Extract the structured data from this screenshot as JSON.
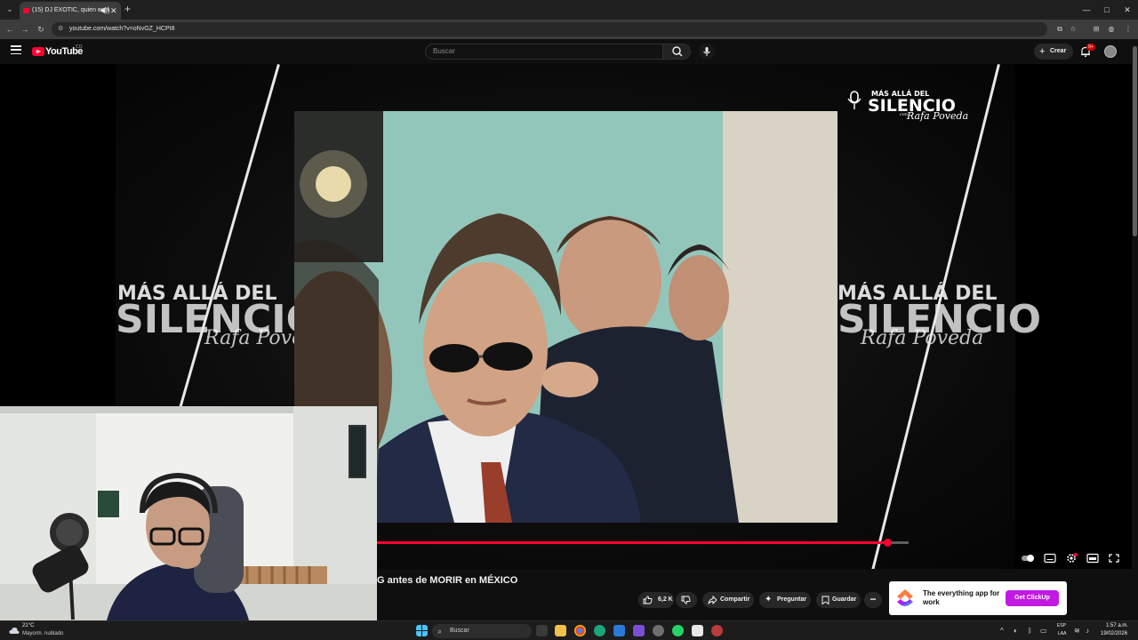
{
  "browser": {
    "tab_title": "(15) DJ EXOTIC, quien está",
    "tab_close": "✕",
    "tab_audio": "◀))",
    "url": "youtube.com/watch?v=oNvGZ_HCPI8",
    "new_tab": "+",
    "window_controls": [
      "—",
      "□",
      "✕"
    ]
  },
  "youtube": {
    "logo_text": "YouTube",
    "country_code": "CO",
    "search_placeholder": "Buscar",
    "create_label": "Crear",
    "notification_count": "9+"
  },
  "video": {
    "overlay_brand_line1": "MÁS ALLÁ DEL",
    "overlay_brand_line2": "SILENCIO",
    "overlay_brand_con": "con",
    "overlay_brand_script": "Rafa Poveda",
    "title": "G antes de MORIR en MÉXICO",
    "progress_fraction": 0.96,
    "icons": [
      "autoplay-toggle-icon",
      "subtitles-icon",
      "settings-icon",
      "miniplayer-icon",
      "fullscreen-icon"
    ]
  },
  "actions": {
    "like_count": "6,2 K",
    "share_label": "Compartir",
    "ask_label": "Preguntar",
    "save_label": "Guardar",
    "more": "•••"
  },
  "ad": {
    "headline": "The everything app for work",
    "cta": "Get ClickUp"
  },
  "taskbar": {
    "weather_temp": "21°C",
    "weather_condition": "Mayorm. nublado",
    "search_label": "Buscar",
    "lang_line1": "ESP",
    "lang_line2": "LAA",
    "time": "1:57 a.m.",
    "date": "19/02/2026"
  },
  "colors": {
    "youtube_red": "#ff0033",
    "clickup_purple": "#c219e3",
    "background": "#0f0f0f"
  }
}
